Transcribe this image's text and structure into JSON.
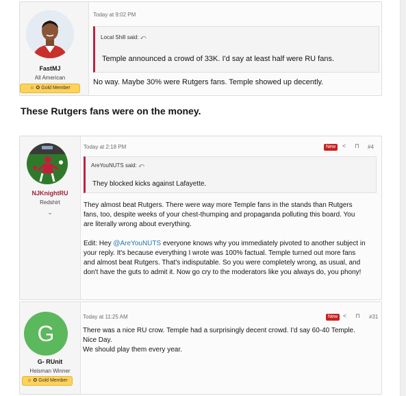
{
  "posts": [
    {
      "username": "FastMJ",
      "user_title": "All American",
      "member_badge": "Gold Member",
      "date": "Today at 9:02 PM",
      "quote": {
        "author": "Local Shill said:",
        "text": "Temple announced a crowd of 33K. I'd say at least half were RU fans."
      },
      "message": "No way. Maybe 30% were Rutgers fans. Temple showed up decently."
    },
    {
      "username": "NJKnightRU",
      "user_title": "Redshirt",
      "date": "Today at 2:18 PM",
      "new_label": "New",
      "post_number": "#4",
      "quote": {
        "author": "AreYouNUTS said:",
        "text": "They blocked kicks against Lafayette."
      },
      "message_p1": [
        "They almost beat Rutgers. There were way more Temple fans in the stands than Rutgers",
        "fans, too, despite weeks of your chest-thumping and propaganda polluting this board. You",
        "are literally wrong about everything."
      ],
      "message_p2_prefix": "Edit: Hey ",
      "message_p2_mention": "@AreYouNUTS",
      "message_p2_suffix": " everyone knows why you immediately pivoted to another subject in",
      "message_p2_rest": [
        "your reply. It's because everything I wrote was 100% factual. Temple turned out more fans",
        "and almost beat Rutgers. That's indisputable. So you were completely wrong, as usual, and",
        "don't have the guts to admit it. Now go cry to the moderators like you always do, you phony!"
      ]
    },
    {
      "username": "G- RUnit",
      "user_title": "Heisman Winner",
      "member_badge": "Gold Member",
      "avatar_letter": "G",
      "date": "Today at 11:25 AM",
      "new_label": "New",
      "post_number": "#31",
      "message": [
        "There was a nice RU crow. Temple had a surprisingly decent crowd. I'd say 60-40 Temple.",
        "Nice Day.",
        "We should play them every year."
      ]
    }
  ],
  "caption": "These Rutgers fans were on the money.",
  "colors": {
    "accent": "#bd2340",
    "new_badge": "#c92020",
    "gold": "#ffd25a",
    "link": "#2577b1",
    "avatar_green": "#5cb85c"
  }
}
